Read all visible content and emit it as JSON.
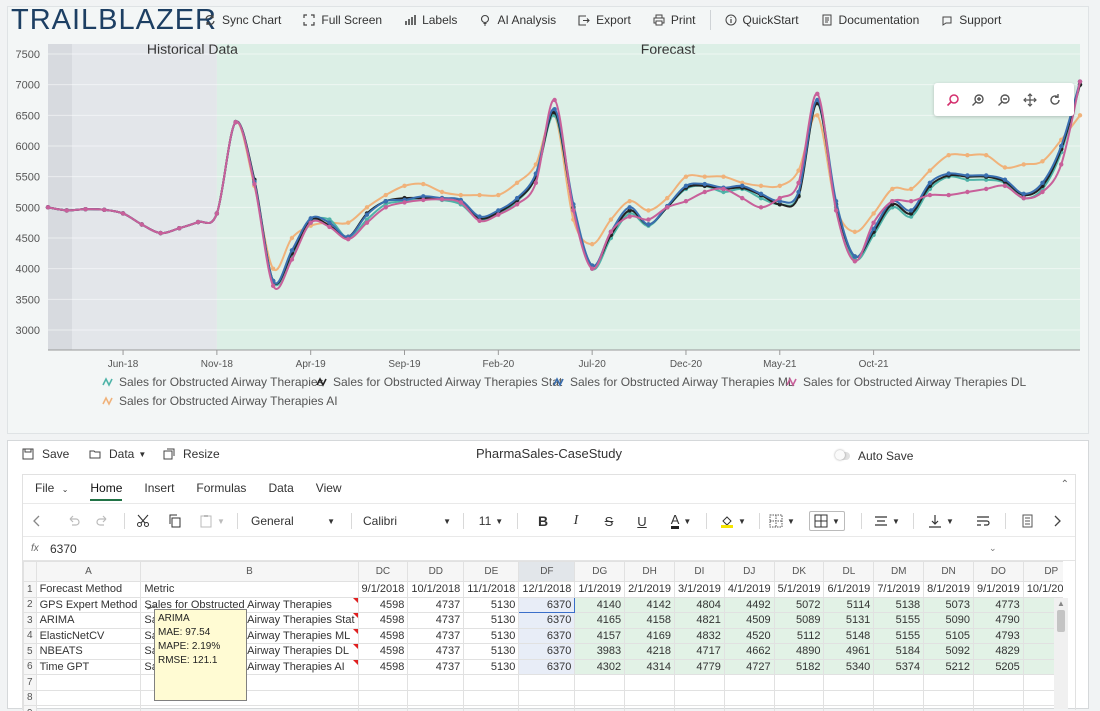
{
  "app": {
    "logo": "TRAILBLAZER",
    "toolbar": [
      {
        "label": "Sync Chart",
        "icon": "sync-icon"
      },
      {
        "label": "Full Screen",
        "icon": "expand-icon"
      },
      {
        "label": "Labels",
        "icon": "bar-chart-icon"
      },
      {
        "label": "AI Analysis",
        "icon": "lightbulb-icon"
      },
      {
        "label": "Export",
        "icon": "export-icon"
      },
      {
        "label": "Print",
        "icon": "print-icon"
      },
      {
        "label": "QuickStart",
        "icon": "info-icon"
      },
      {
        "label": "Documentation",
        "icon": "document-icon"
      },
      {
        "label": "Support",
        "icon": "support-icon"
      }
    ]
  },
  "chart_data": {
    "type": "line",
    "regions": [
      {
        "label": "Historical Data",
        "x_end": "Nov-18"
      },
      {
        "label": "Forecast"
      }
    ],
    "x_ticks": [
      "Jun-18",
      "Nov-18",
      "Apr-19",
      "Sep-19",
      "Feb-20",
      "Jul-20",
      "Dec-20",
      "May-21",
      "Oct-21"
    ],
    "ylim": [
      3000,
      7500
    ],
    "y_ticks": [
      3000,
      3500,
      4000,
      4500,
      5000,
      5500,
      6000,
      6500,
      7000,
      7500
    ],
    "x_start_month": "Feb-18",
    "series": [
      {
        "name": "Sales for Obstructed Airway Therapies",
        "color": "#4fb3a8",
        "values": [
          5000,
          4950,
          4970,
          4960,
          4900,
          4720,
          4580,
          4660,
          4760,
          4900,
          6390,
          5400,
          3780,
          4200,
          4750,
          4800,
          4500,
          4800,
          5050,
          5100,
          5150,
          5120,
          5050,
          4800,
          4900,
          5100,
          5500,
          6500,
          5000,
          4000,
          4500,
          4900,
          4700,
          5000,
          5300,
          5350,
          5250,
          5300,
          5150,
          5050,
          5200,
          6700,
          5000,
          4150,
          4550,
          5000,
          4850,
          5300,
          5500,
          5450,
          5450,
          5400,
          5150,
          5300,
          5900,
          7000
        ]
      },
      {
        "name": "Sales for Obstructed Airway Therapies Stat",
        "color": "#222222",
        "values": [
          5000,
          4950,
          4970,
          4960,
          4900,
          4720,
          4580,
          4660,
          4760,
          4900,
          6390,
          5450,
          3800,
          4250,
          4800,
          4700,
          4520,
          4900,
          5100,
          5150,
          5150,
          5150,
          5100,
          4820,
          4920,
          5120,
          5500,
          6550,
          5000,
          4050,
          4550,
          4950,
          4720,
          5000,
          5320,
          5350,
          5300,
          5320,
          5200,
          5050,
          5180,
          6700,
          5050,
          4200,
          4600,
          5050,
          4900,
          5350,
          5520,
          5500,
          5500,
          5420,
          5200,
          5350,
          5950,
          7000
        ]
      },
      {
        "name": "Sales for Obstructed Airway Therapies ML",
        "color": "#3a6fb0",
        "values": [
          5000,
          4950,
          4970,
          4960,
          4900,
          4720,
          4580,
          4660,
          4760,
          4900,
          6390,
          5420,
          3800,
          4300,
          4820,
          4750,
          4520,
          4880,
          5100,
          5120,
          5180,
          5150,
          5120,
          4850,
          4950,
          5150,
          5550,
          6600,
          5050,
          4050,
          4600,
          5000,
          4720,
          5020,
          5350,
          5380,
          5320,
          5350,
          5220,
          5100,
          5250,
          6750,
          5100,
          4200,
          4650,
          5100,
          4950,
          5400,
          5550,
          5520,
          5520,
          5450,
          5220,
          5400,
          6000,
          7050
        ]
      },
      {
        "name": "Sales for Obstructed Airway Therapies DL",
        "color": "#c8609a",
        "values": [
          5000,
          4950,
          4970,
          4960,
          4900,
          4720,
          4580,
          4660,
          4760,
          4900,
          6390,
          5380,
          3720,
          4150,
          4750,
          4680,
          4480,
          4750,
          5000,
          5080,
          5120,
          5130,
          5080,
          4780,
          4880,
          5050,
          5400,
          6750,
          4950,
          4000,
          4600,
          4850,
          4800,
          5000,
          5100,
          5250,
          5300,
          5150,
          5000,
          5150,
          5400,
          6850,
          4950,
          4120,
          4750,
          5100,
          5100,
          5200,
          5200,
          5250,
          5300,
          5350,
          5150,
          5250,
          5700,
          7050
        ]
      },
      {
        "name": "Sales for Obstructed Airway Therapies AI",
        "color": "#f0b27a",
        "values": [
          5000,
          4950,
          4970,
          4960,
          4900,
          4720,
          4580,
          4660,
          4760,
          4900,
          6390,
          5350,
          4000,
          4500,
          4700,
          4750,
          4750,
          5000,
          5200,
          5350,
          5380,
          5250,
          5200,
          5200,
          5200,
          5400,
          5700,
          6500,
          4800,
          4400,
          4800,
          5100,
          4950,
          5150,
          5500,
          5500,
          5500,
          5400,
          5350,
          5350,
          5600,
          6500,
          5000,
          4600,
          4900,
          5300,
          5300,
          5600,
          5850,
          5850,
          5850,
          5650,
          5700,
          5750,
          6100,
          6500
        ]
      }
    ]
  },
  "sheet": {
    "buttons": {
      "save": "Save",
      "data": "Data",
      "resize": "Resize"
    },
    "title": "PharmaSales-CaseStudy",
    "auto_save": "Auto Save",
    "menu": [
      "File",
      "Home",
      "Insert",
      "Formulas",
      "Data",
      "View"
    ],
    "ribbon": {
      "number_format": "General",
      "font": "Calibri",
      "font_size": "11"
    },
    "formula": {
      "label": "fx",
      "value": "6370"
    },
    "columns": [
      "A",
      "B",
      "DC",
      "DD",
      "DE",
      "DF",
      "DG",
      "DH",
      "DI",
      "DJ",
      "DK",
      "DL",
      "DM",
      "DN",
      "DO",
      "DP"
    ],
    "header_row": [
      "Forecast Method",
      "Metric",
      "9/1/2018",
      "10/1/2018",
      "11/1/2018",
      "12/1/2018",
      "1/1/2019",
      "2/1/2019",
      "3/1/2019",
      "4/1/2019",
      "5/1/2019",
      "6/1/2019",
      "7/1/2019",
      "8/1/2019",
      "9/1/2019",
      "10/1/2019"
    ],
    "rows": [
      [
        "GPS Expert Method",
        "Sales for Obstructed Airway Therapies",
        "4598",
        "4737",
        "5130",
        "6370",
        "4140",
        "4142",
        "4804",
        "4492",
        "5072",
        "5114",
        "5138",
        "5073",
        "4773",
        "4"
      ],
      [
        "ARIMA",
        "Sales for Obstructed Airway Therapies Stat",
        "4598",
        "4737",
        "5130",
        "6370",
        "4165",
        "4158",
        "4821",
        "4509",
        "5089",
        "5131",
        "5155",
        "5090",
        "4790",
        "4"
      ],
      [
        "ElasticNetCV",
        "Sales for Obstructed Airway Therapies ML",
        "4598",
        "4737",
        "5130",
        "6370",
        "4157",
        "4169",
        "4832",
        "4520",
        "5112",
        "5148",
        "5155",
        "5105",
        "4793",
        "4"
      ],
      [
        "NBEATS",
        "Sales for Obstructed Airway Therapies DL",
        "4598",
        "4737",
        "5130",
        "6370",
        "3983",
        "4218",
        "4717",
        "4662",
        "4890",
        "4961",
        "5184",
        "5092",
        "4829",
        "5"
      ],
      [
        "Time GPT",
        "Sales for Obstructed Airway Therapies AI",
        "4598",
        "4737",
        "5130",
        "6370",
        "4302",
        "4314",
        "4779",
        "4727",
        "5182",
        "5340",
        "5374",
        "5212",
        "5205",
        "5"
      ]
    ],
    "row_numbers": [
      "1",
      "2",
      "3",
      "4",
      "5",
      "6",
      "7",
      "8",
      "9"
    ],
    "note": {
      "title": "ARIMA",
      "lines": [
        "MAE: 97.54",
        "MAPE: 2.19%",
        "RMSE: 121.1"
      ]
    }
  }
}
